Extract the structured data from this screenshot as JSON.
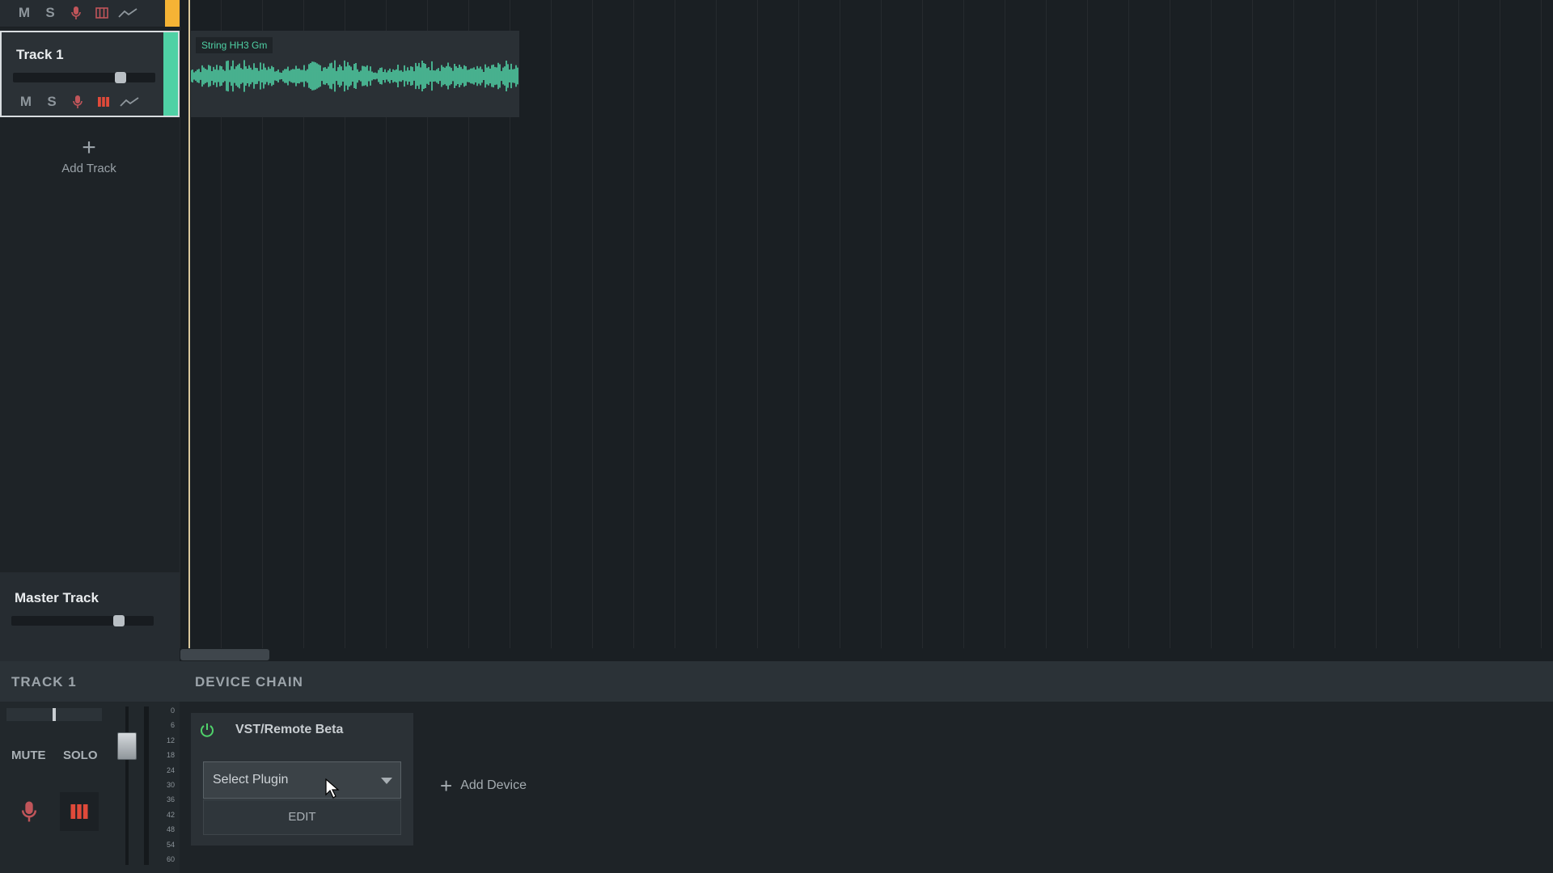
{
  "tracks": {
    "previous": {
      "mute": "M",
      "solo": "S",
      "color": "#f5b335"
    },
    "selected": {
      "name": "Track 1",
      "mute": "M",
      "solo": "S",
      "color": "#4fd1a5",
      "volume": 0.78
    },
    "add_track_label": "Add Track"
  },
  "master": {
    "name": "Master Track",
    "volume": 0.78
  },
  "timeline": {
    "clip": {
      "label": "String HH3 Gm",
      "color": "#4fd1a5"
    }
  },
  "bottom": {
    "track_section": "TRACK 1",
    "device_chain_section": "DEVICE CHAIN",
    "mute_label": "MUTE",
    "solo_label": "SOLO",
    "pan": 0.5,
    "db_scale": [
      "0",
      "6",
      "12",
      "18",
      "24",
      "30",
      "36",
      "42",
      "48",
      "54",
      "60"
    ],
    "device": {
      "title": "VST/Remote Beta",
      "select_value": "Select Plugin",
      "edit_label": "EDIT"
    },
    "add_device_label": "Add Device"
  },
  "icons": {
    "record": "microphone-icon",
    "monitor": "piano-keys-icon",
    "automation": "automation-line-icon",
    "power": "power-icon"
  }
}
